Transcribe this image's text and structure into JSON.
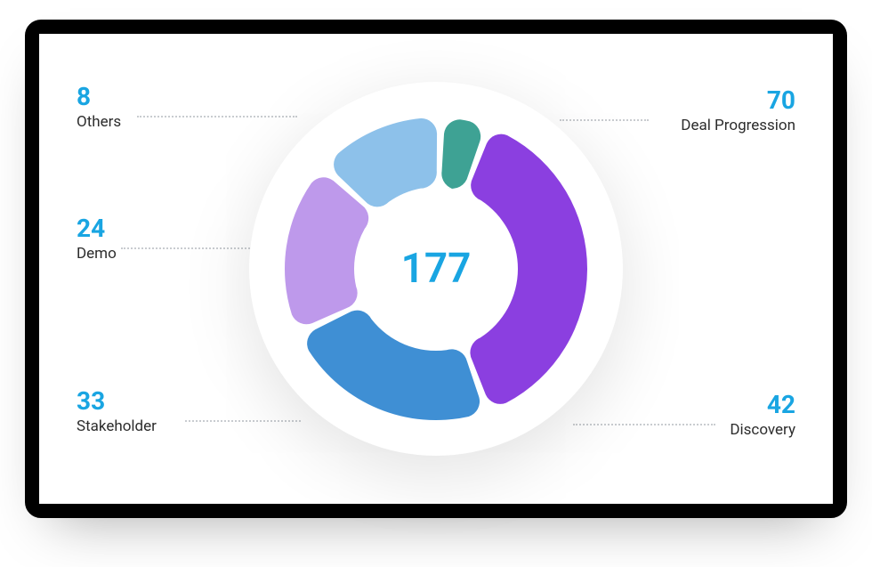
{
  "chart_data": {
    "type": "pie",
    "total": 177,
    "total_label": "177",
    "series": [
      {
        "name": "Deal Progression",
        "value": 70,
        "color": "#8B3FE0"
      },
      {
        "name": "Discovery",
        "value": 42,
        "color": "#3F8FD4"
      },
      {
        "name": "Stakeholder",
        "value": 33,
        "color": "#BE99EB"
      },
      {
        "name": "Demo",
        "value": 24,
        "color": "#8DC1EA"
      },
      {
        "name": "Others",
        "value": 8,
        "color": "#3EA294"
      }
    ],
    "start_angle_deg": -68,
    "gap_deg": 3,
    "corner_radius": 18,
    "inner_radius": 92,
    "outer_radius": 170,
    "accent_color": "#19A5E2",
    "text_color": "#2c2c2c"
  },
  "callouts": {
    "deal_progression": {
      "value": "70",
      "label": "Deal Progression"
    },
    "discovery": {
      "value": "42",
      "label": "Discovery"
    },
    "stakeholder": {
      "value": "33",
      "label": "Stakeholder"
    },
    "demo": {
      "value": "24",
      "label": "Demo"
    },
    "others": {
      "value": "8",
      "label": "Others"
    }
  }
}
